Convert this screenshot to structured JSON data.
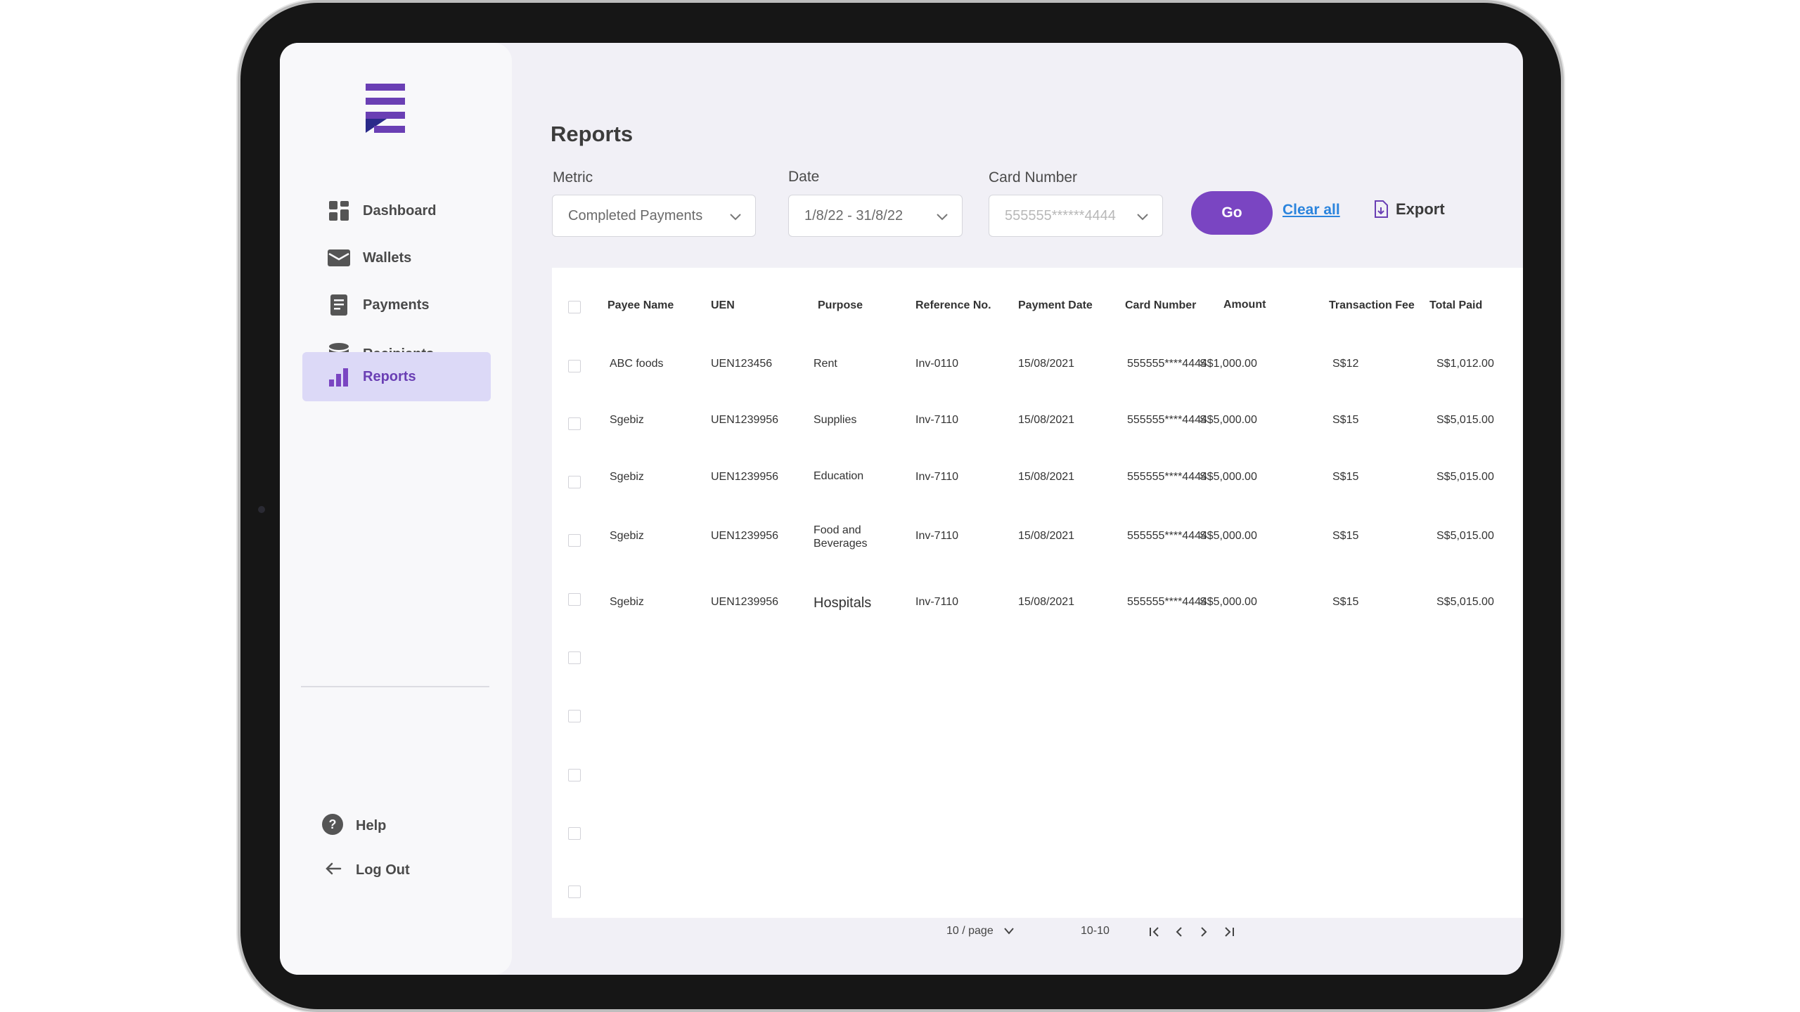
{
  "colors": {
    "accent": "#7a45c2",
    "link": "#2b84dd",
    "active_bg": "#dcd9f7"
  },
  "sidebar": {
    "items": [
      {
        "label": "Dashboard",
        "icon": "grid-icon"
      },
      {
        "label": "Wallets",
        "icon": "wallet-icon"
      },
      {
        "label": "Payments",
        "icon": "document-icon"
      },
      {
        "label": "Recipients",
        "icon": "database-icon"
      },
      {
        "label": "Reports",
        "icon": "bar-chart-icon",
        "active": true
      }
    ],
    "help": "Help",
    "logout": "Log Out"
  },
  "page": {
    "title": "Reports"
  },
  "filters": {
    "metric_label": "Metric",
    "metric_value": "Completed Payments",
    "date_label": "Date",
    "date_value": "1/8/22 - 31/8/22",
    "card_label": "Card Number",
    "card_value": "555555******4444",
    "go": "Go",
    "clear_all": "Clear all",
    "export": "Export"
  },
  "table": {
    "headers": [
      "Payee Name",
      "UEN",
      "Purpose",
      "Reference No.",
      "Payment Date",
      "Card Number",
      "Amount",
      "Transaction Fee",
      "Total Paid"
    ],
    "rows": [
      [
        "ABC foods",
        "UEN123456",
        "Rent",
        "Inv-0110",
        "15/08/2021",
        "555555****4444",
        "S$1,000.00",
        "S$12",
        "S$1,012.00"
      ],
      [
        "Sgebiz",
        "UEN1239956",
        "Supplies",
        "Inv-7110",
        "15/08/2021",
        "555555****4444",
        "S$5,000.00",
        "S$15",
        "S$5,015.00"
      ],
      [
        "Sgebiz",
        "UEN1239956",
        "Education",
        "Inv-7110",
        "15/08/2021",
        "555555****4444",
        "S$5,000.00",
        "S$15",
        "S$5,015.00"
      ],
      [
        "Sgebiz",
        "UEN1239956",
        "Food and Beverages",
        "Inv-7110",
        "15/08/2021",
        "555555****4444",
        "S$5,000.00",
        "S$15",
        "S$5,015.00"
      ],
      [
        "Sgebiz",
        "UEN1239956",
        "Hospitals",
        "Inv-7110",
        "15/08/2021",
        "555555****4444",
        "S$5,000.00",
        "S$15",
        "S$5,015.00"
      ]
    ]
  },
  "pagination": {
    "page_size": "10 / page",
    "range": "10-10"
  }
}
